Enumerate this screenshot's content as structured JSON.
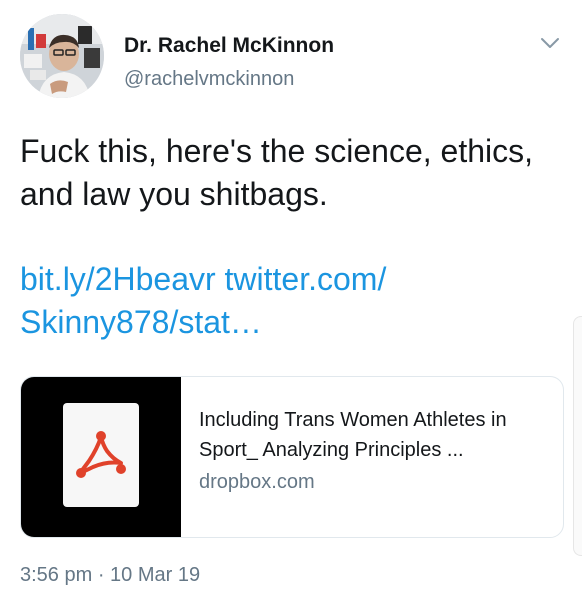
{
  "tweet": {
    "author_name": "Dr. Rachel McKinnon",
    "handle": "@rachelvmckinnon",
    "text": "Fuck this, here's the science, ethics, and law you shitbags.",
    "link_1": "bit.ly/2Hbeavr",
    "link_2": "twitter.com/​Skinny878/stat…",
    "timestamp": "3:56 pm · 10 Mar 19",
    "link_card": {
      "title": "Including Trans Women Athletes in Sport_ Analyzing Principles ...",
      "domain": "dropbox.com",
      "icon": "pdf-icon"
    }
  },
  "icons": {
    "menu": "chevron-down-icon",
    "pdf": "pdf-icon"
  },
  "colors": {
    "link": "#1b95e0",
    "secondary_text": "#657786",
    "pdf_accent": "#e0422b",
    "card_border": "#e1e8ed"
  }
}
